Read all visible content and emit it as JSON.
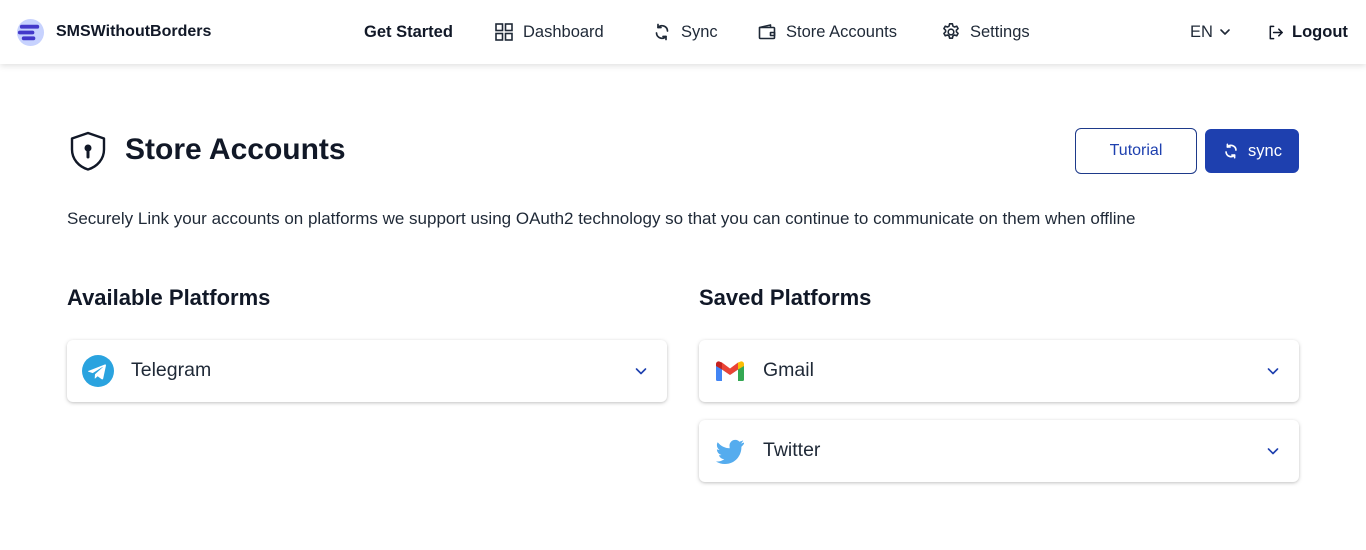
{
  "brand": {
    "name": "SMSWithoutBorders"
  },
  "nav": {
    "get_started": "Get Started",
    "dashboard": "Dashboard",
    "sync": "Sync",
    "store_accounts": "Store Accounts",
    "settings": "Settings",
    "language": "EN",
    "logout": "Logout"
  },
  "page": {
    "title": "Store Accounts",
    "tutorial_label": "Tutorial",
    "sync_label": "sync",
    "description": "Securely Link your accounts on platforms we support using OAuth2 technology so that you can continue to communicate on them when offline"
  },
  "available": {
    "title": "Available Platforms",
    "items": [
      {
        "label": "Telegram",
        "icon": "telegram-icon"
      }
    ]
  },
  "saved": {
    "title": "Saved Platforms",
    "items": [
      {
        "label": "Gmail",
        "icon": "gmail-icon"
      },
      {
        "label": "Twitter",
        "icon": "twitter-icon"
      }
    ]
  },
  "colors": {
    "primary": "#1e40af",
    "brand_logo": "#4f46e5",
    "telegram": "#2aa3df",
    "twitter": "#55acee"
  }
}
